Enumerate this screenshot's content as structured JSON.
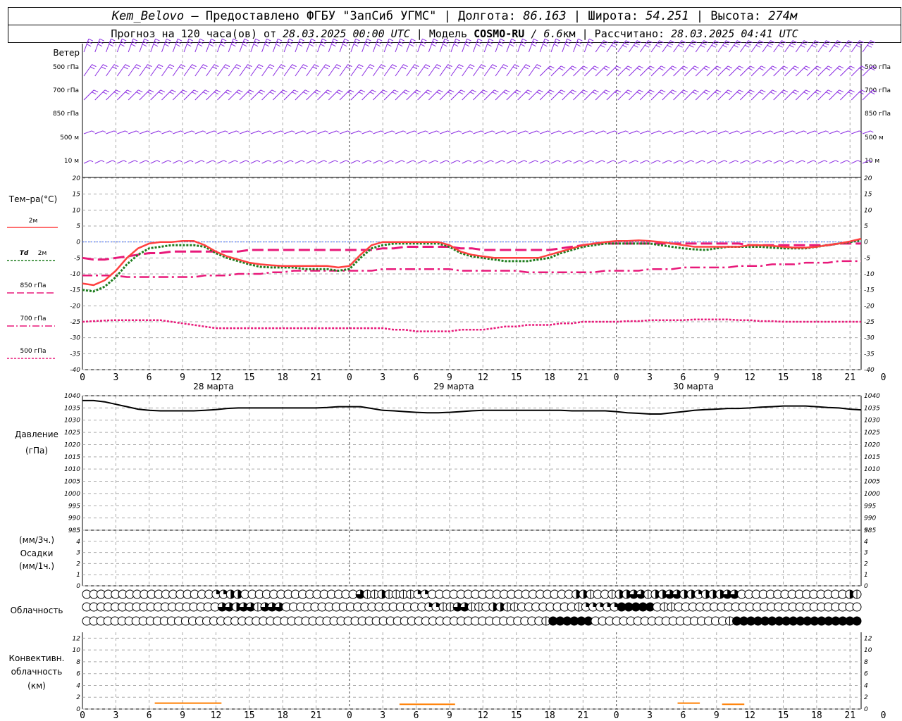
{
  "header": {
    "station": "Kem_Belovo",
    "provider": " – Предоставлено ФГБУ \"ЗапСиб УГМС\" | Долгота: ",
    "lon": "86.163",
    "lat_label": " | Широта: ",
    "lat": "54.251",
    "alt_label": " | Высота: ",
    "alt": "274м",
    "forecast_label": "Прогноз на 120 часа(ов) от ",
    "init": "28.03.2025 00:00 UTC",
    "model_label": " | Модель ",
    "model": "COSMO-RU",
    "res": " / 6.6",
    "res_unit": "км",
    "calc_label": " | Рассчитано: ",
    "calc": "28.03.2025 04:41 UTC"
  },
  "labels": {
    "wind": "Ветер",
    "levels": [
      "500 гПа",
      "700 гПа",
      "850 гПа",
      "500 м",
      "10  м"
    ],
    "temp": "Тем–ра(°C)",
    "t2m": "2м",
    "td": "Td",
    "td2m": "2м",
    "t850": "850 гПа",
    "t700": "700 гПа",
    "t500": "500 гПа",
    "pressure": "Давление",
    "pressure_unit": "(гПа)",
    "precip_unit1": "(мм/3ч.)",
    "precip": "Осадки",
    "precip_unit2": "(мм/1ч.)",
    "cloud": "Облачность",
    "conv1": "Конвективн.",
    "conv2": "облачность",
    "conv3": "(км)"
  },
  "colors": {
    "wind": "#8a2be2",
    "t2m": "#ff4040",
    "td": "#1e7d1e",
    "t850": "#e8197a",
    "t700": "#e8197a",
    "t500": "#e8197a",
    "zero": "#3060ff",
    "conv": "#ff7f00"
  },
  "chart_data": [
    {
      "type": "line",
      "xticks": [
        "0",
        "3",
        "6",
        "9",
        "12",
        "15",
        "18",
        "21",
        "0",
        "3",
        "6",
        "9",
        "12",
        "15",
        "18",
        "21",
        "0",
        "3",
        "6",
        "9",
        "12",
        "15",
        "18",
        "21",
        "0",
        "3",
        "6"
      ],
      "days": [
        "28 марта",
        "29 марта",
        "30 марта"
      ],
      "ylim": [
        -40,
        20
      ],
      "yticks": [
        20,
        15,
        10,
        5,
        0,
        -5,
        -10,
        -15,
        -20,
        -25,
        -30,
        -35,
        -40
      ],
      "series": [
        {
          "name": "2м",
          "key": "t2m",
          "values": [
            -13,
            -13.5,
            -12,
            -9,
            -5,
            -2,
            -0.5,
            0,
            0,
            0.3,
            0.3,
            -1,
            -3,
            -4.5,
            -5.5,
            -6.5,
            -7,
            -7.3,
            -7.5,
            -7.5,
            -7.5,
            -7.5,
            -7.5,
            -8,
            -7.5,
            -4,
            -1,
            0,
            0,
            0,
            0,
            0,
            0,
            -1,
            -3,
            -4,
            -4.5,
            -5,
            -5,
            -5,
            -5,
            -5,
            -4,
            -3,
            -2,
            -1,
            -0.5,
            0,
            0.3,
            0.3,
            0.5,
            0.3,
            0,
            -0.5,
            -1,
            -1.5,
            -1.5,
            -1.5,
            -1.5,
            -1.5,
            -1,
            -1,
            -1.2,
            -1.5,
            -1.8,
            -1.8,
            -1.5,
            -1,
            -0.5,
            0.2,
            1
          ]
        },
        {
          "name": "Td 2м",
          "key": "td",
          "values": [
            -15,
            -15.5,
            -14,
            -11,
            -7,
            -4,
            -2,
            -1.5,
            -1,
            -1,
            -1,
            -1.5,
            -3.5,
            -5,
            -6,
            -7,
            -7.8,
            -8,
            -8,
            -8,
            -8.5,
            -8.5,
            -8.5,
            -9,
            -8.5,
            -5,
            -2,
            -1,
            -0.5,
            -0.5,
            -0.5,
            -0.5,
            -0.5,
            -1.5,
            -3.5,
            -4.5,
            -5,
            -5.5,
            -6,
            -6,
            -6,
            -5.5,
            -5,
            -3.5,
            -2.5,
            -1.5,
            -1,
            -0.5,
            -0.5,
            -0.5,
            -0.5,
            -0.5,
            -1,
            -1.5,
            -2,
            -2.3,
            -2.5,
            -2,
            -1.5,
            -1.5,
            -1.5,
            -1.5,
            -1.8,
            -2,
            -2,
            -2,
            -1.5,
            -1,
            -0.5,
            0,
            0.5
          ]
        },
        {
          "name": "850 гПа",
          "key": "t850",
          "values": [
            -5,
            -5.5,
            -5.5,
            -5,
            -4.5,
            -4,
            -3.5,
            -3.5,
            -3,
            -3,
            -3,
            -3,
            -3,
            -3,
            -3,
            -2.5,
            -2.5,
            -2.5,
            -2.5,
            -2.5,
            -2.5,
            -2.5,
            -2.5,
            -2.5,
            -2.5,
            -2.5,
            -2.5,
            -2,
            -2,
            -1.5,
            -1.5,
            -1.5,
            -1.5,
            -1.5,
            -2,
            -2,
            -2.5,
            -2.5,
            -2.5,
            -2.5,
            -2.5,
            -2.5,
            -2.5,
            -2,
            -1.5,
            -1,
            -0.5,
            -0.5,
            -0.5,
            -0.5,
            -0.5,
            -0.5,
            -0.5,
            -0.5,
            -0.5,
            -0.5,
            -0.5,
            -0.5,
            -0.5,
            -0.5,
            -1,
            -1,
            -1,
            -1,
            -1,
            -1,
            -1,
            -1,
            -0.5,
            -0.5,
            -0.5
          ]
        },
        {
          "name": "700 гПа",
          "key": "t700",
          "values": [
            -10.5,
            -10.5,
            -10.5,
            -10.5,
            -11,
            -11,
            -11,
            -11,
            -11,
            -11,
            -11,
            -10.5,
            -10.5,
            -10.5,
            -10,
            -10,
            -10,
            -9.5,
            -9.5,
            -9,
            -9,
            -9,
            -9,
            -9,
            -9,
            -9,
            -9,
            -8.5,
            -8.5,
            -8.5,
            -8.5,
            -8.5,
            -8.5,
            -8.5,
            -9,
            -9,
            -9,
            -9,
            -9,
            -9,
            -9.5,
            -9.5,
            -9.5,
            -9.5,
            -9.5,
            -9.5,
            -9.5,
            -9,
            -9,
            -9,
            -9,
            -8.5,
            -8.5,
            -8.5,
            -8,
            -8,
            -8,
            -8,
            -8,
            -7.5,
            -7.5,
            -7.5,
            -7,
            -7,
            -7,
            -6.5,
            -6.5,
            -6.5,
            -6,
            -6,
            -6
          ]
        },
        {
          "name": "500 гПа",
          "key": "t500",
          "values": [
            -25,
            -24.8,
            -24.6,
            -24.5,
            -24.5,
            -24.5,
            -24.5,
            -24.5,
            -25,
            -25.5,
            -26,
            -26.5,
            -27,
            -27,
            -27,
            -27,
            -27,
            -27,
            -27,
            -27,
            -27,
            -27,
            -27,
            -27,
            -27,
            -27,
            -27,
            -27,
            -27.5,
            -27.5,
            -28,
            -28,
            -28,
            -28,
            -27.5,
            -27.5,
            -27.5,
            -27,
            -26.5,
            -26.5,
            -26,
            -26,
            -26,
            -25.5,
            -25.5,
            -25,
            -25,
            -25,
            -25,
            -24.8,
            -24.8,
            -24.5,
            -24.5,
            -24.5,
            -24.5,
            -24.3,
            -24.3,
            -24.3,
            -24.3,
            -24.5,
            -24.5,
            -24.8,
            -24.8,
            -25,
            -25,
            -25,
            -25,
            -25,
            -25,
            -25,
            -25
          ]
        }
      ]
    },
    {
      "type": "line",
      "ylim": [
        985,
        1040
      ],
      "yticks": [
        1040,
        1035,
        1030,
        1025,
        1020,
        1015,
        1010,
        1005,
        1000,
        995,
        990,
        985
      ],
      "series": [
        {
          "name": "Давление",
          "key": "press",
          "values": [
            1038,
            1038,
            1037.5,
            1036.5,
            1035.5,
            1034.5,
            1034,
            1033.8,
            1033.8,
            1033.8,
            1033.8,
            1034,
            1034.3,
            1034.8,
            1035,
            1035,
            1035,
            1035,
            1035,
            1035,
            1035,
            1035,
            1035.2,
            1035.5,
            1035.5,
            1035.5,
            1034.8,
            1034,
            1033.8,
            1033.5,
            1033.2,
            1033,
            1033,
            1033.2,
            1033.5,
            1033.8,
            1034,
            1034,
            1034,
            1034,
            1034,
            1034,
            1034,
            1034,
            1033.8,
            1033.8,
            1033.8,
            1033.8,
            1033.5,
            1033,
            1032.8,
            1032.5,
            1032.5,
            1033,
            1033.5,
            1034,
            1034.3,
            1034.5,
            1034.8,
            1034.8,
            1035,
            1035.3,
            1035.5,
            1035.8,
            1035.8,
            1035.8,
            1035.5,
            1035.2,
            1035,
            1034.5,
            1034.2
          ]
        }
      ]
    },
    {
      "type": "bar",
      "name": "Осадки",
      "ylim": [
        0,
        5
      ],
      "yticks": [
        5,
        4,
        3,
        2,
        1,
        0
      ],
      "values": []
    },
    {
      "type": "table",
      "name": "Облачность",
      "rows": [
        "000000000000000000DDHH0000000000000000ALLHLLLLDD00000000000000000000HHL00LHHMMLHHMMHHDHHHMM000000000000000HL",
        "0000000000000000000AAHAMLMMM00000000000000000000DDLLAMLL0HHLL00000000LDDDDDFFFFF0LL00000000000000000000000000",
        "00000000000000000000000000000000000000000000000000000000000000000LFFFFFF0000000000000000000LFFFFFFFFFFFFFFFFFF"
      ]
    },
    {
      "type": "line",
      "name": "Конвективн. облачность",
      "ylim": [
        0,
        13
      ],
      "yticks": [
        12,
        10,
        8,
        6,
        4,
        2,
        0
      ],
      "segments": [
        {
          "x": [
            6.5,
            12.5
          ],
          "y": [
            1,
            1
          ]
        },
        {
          "x": [
            28.5,
            33.5
          ],
          "y": [
            0.8,
            0.8
          ]
        },
        {
          "x": [
            53.5,
            55.5
          ],
          "y": [
            1,
            1
          ]
        },
        {
          "x": [
            57.5,
            59.5
          ],
          "y": [
            0.8,
            0.8
          ]
        }
      ]
    }
  ]
}
